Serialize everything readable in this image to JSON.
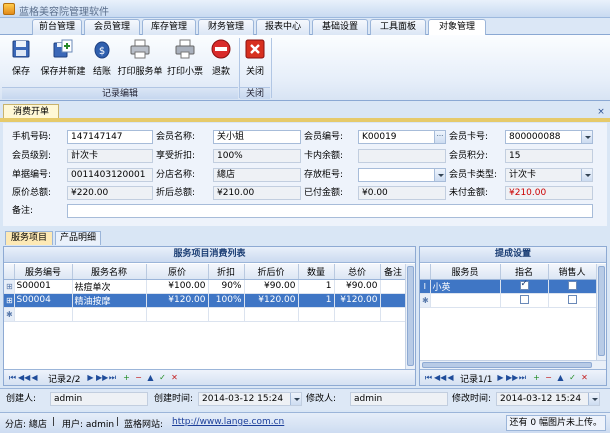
{
  "app": {
    "title": "蓝格美容院管理软件"
  },
  "menu": {
    "tabs": [
      "前台管理",
      "会员管理",
      "库存管理",
      "财务管理",
      "报表中心",
      "基础设置",
      "工具面板",
      "对象管理"
    ],
    "active": 7
  },
  "ribbon": {
    "buttons": [
      {
        "label": "保存",
        "icon": "save-icon"
      },
      {
        "label": "保存并新建",
        "icon": "save-new-icon"
      },
      {
        "label": "结账",
        "icon": "checkout-icon"
      },
      {
        "label": "打印服务单",
        "icon": "printer-icon"
      },
      {
        "label": "打印小票",
        "icon": "receipt-printer-icon"
      },
      {
        "label": "退款",
        "icon": "refund-icon"
      },
      {
        "label": "关闭",
        "icon": "close-icon"
      }
    ],
    "groups": [
      "记录编辑",
      "关闭"
    ]
  },
  "document": {
    "tab": "消费开单",
    "close": "×"
  },
  "form": {
    "phone_label": "手机号码:",
    "phone": "147147147",
    "member_name_label": "会员名称:",
    "member_name": "关小姐",
    "member_no_label": "会员编号:",
    "member_no": "K00019",
    "card_no_label": "会员卡号:",
    "card_no": "800000088",
    "level_label": "会员级别:",
    "level": "計次卡",
    "discount_label": "享受折扣:",
    "discount": "100%",
    "card_balance_label": "卡内余额:",
    "card_balance": "",
    "points_label": "会员积分:",
    "points": "15",
    "bill_no_label": "单据编号:",
    "bill_no": "0011403120001",
    "branch_label": "分店名称:",
    "branch": "總店",
    "cabinet_label": "存放柜号:",
    "cabinet": "",
    "card_type_label": "会员卡类型:",
    "card_type": "计次卡",
    "orig_total_label": "原价总额:",
    "orig_total": "¥220.00",
    "disc_total_label": "折后总额:",
    "disc_total": "¥210.00",
    "paid_label": "已付金额:",
    "paid": "¥0.00",
    "unpaid_label": "未付金额:",
    "unpaid": "¥210.00",
    "remark_label": "备注:",
    "remark": ""
  },
  "subtabs": [
    "服务项目",
    "产品明细"
  ],
  "services": {
    "title": "服务项目消费列表",
    "columns": [
      "服务编号",
      "服务名称",
      "原价",
      "折扣",
      "折后价",
      "数量",
      "总价",
      "备注"
    ],
    "rows": [
      {
        "code": "S00001",
        "name": "祛痘单次",
        "price": "¥100.00",
        "discount": "90%",
        "after": "¥90.00",
        "qty": "1",
        "total": "¥90.00",
        "note": ""
      },
      {
        "code": "S00004",
        "name": "精油按摩",
        "price": "¥120.00",
        "discount": "100%",
        "after": "¥120.00",
        "qty": "1",
        "total": "¥120.00",
        "note": ""
      }
    ],
    "nav": "记录2/2"
  },
  "commission": {
    "title": "提成设置",
    "columns": [
      "服务员",
      "指名",
      "销售人"
    ],
    "rows": [
      {
        "staff": "小英",
        "named": true,
        "seller": false
      }
    ],
    "nav": "记录1/1"
  },
  "footer": {
    "creator_label": "创建人:",
    "creator": "admin",
    "created_label": "创建时间:",
    "created": "2014-03-12 15:24",
    "modifier_label": "修改人:",
    "modifier": "admin",
    "modified_label": "修改时间:",
    "modified": "2014-03-12 15:24"
  },
  "status": {
    "branch": "分店: 總店",
    "user": "用户: admin",
    "site_label": "蓝格网站:",
    "site_url": "http://www.lange.com.cn",
    "upload": "还有 0 幅图片未上传。"
  }
}
